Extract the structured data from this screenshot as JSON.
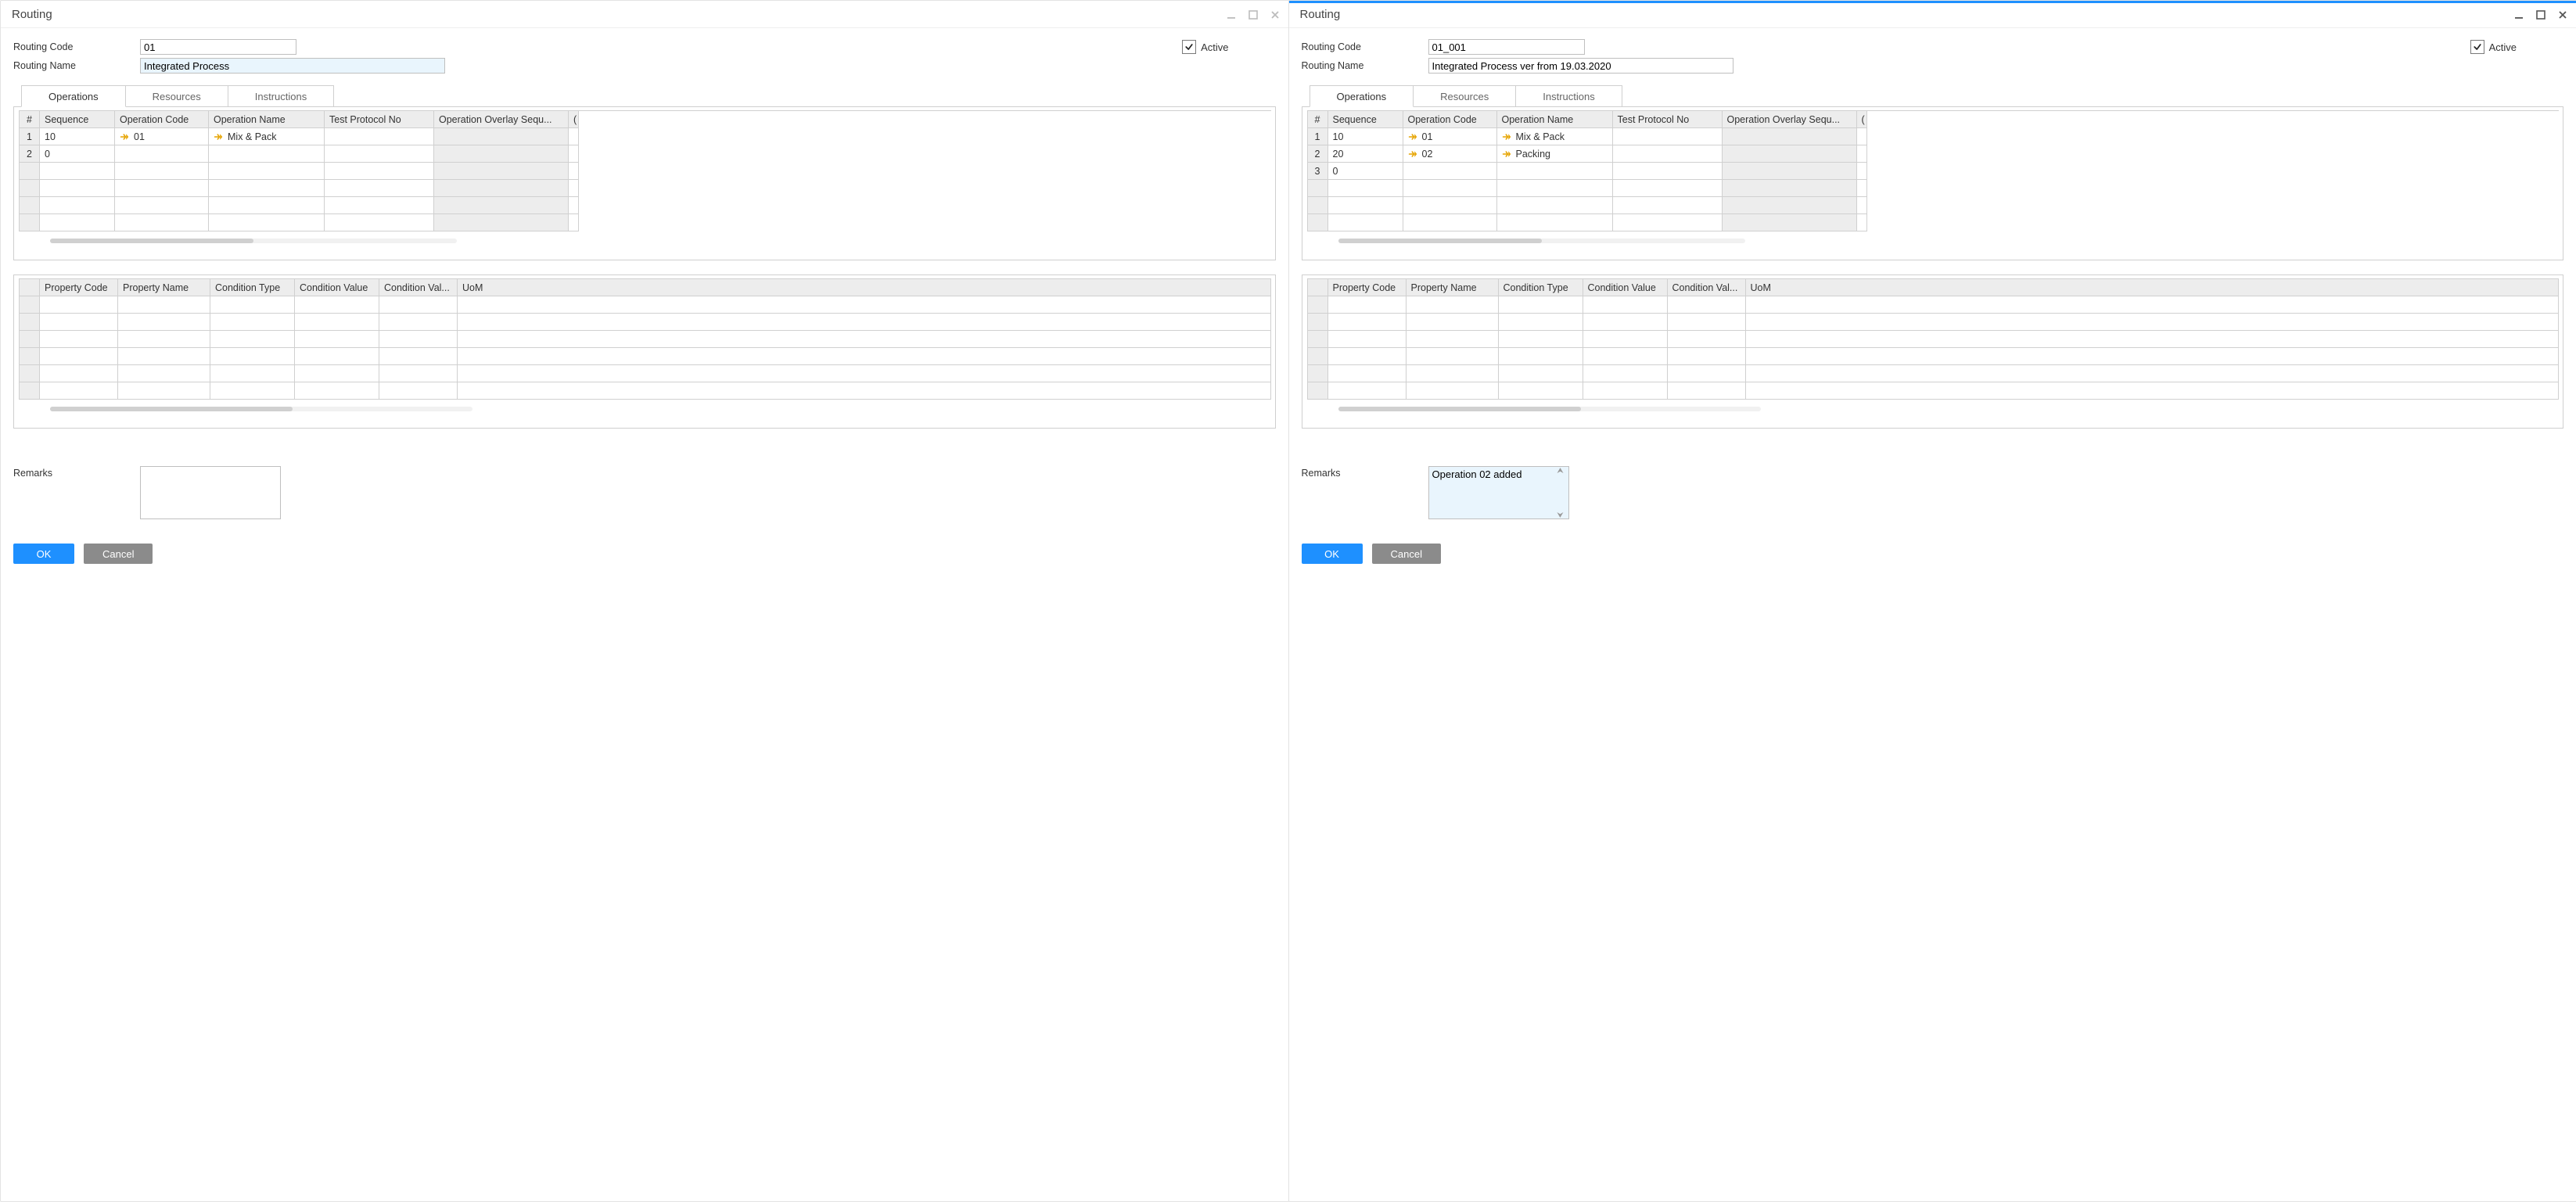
{
  "windows": [
    {
      "title": "Routing",
      "active_window": false,
      "header": {
        "code_label": "Routing Code",
        "name_label": "Routing Name",
        "code": "01",
        "name": "Integrated Process",
        "name_selected": true,
        "active_label": "Active",
        "active": true
      },
      "tabs": {
        "operations": "Operations",
        "resources": "Resources",
        "instructions": "Instructions"
      },
      "ops_grid": {
        "cols": {
          "idx": "#",
          "seq": "Sequence",
          "code": "Operation Code",
          "name": "Operation Name",
          "tp": "Test Protocol No",
          "ov": "Operation Overlay Sequ...",
          "tail": "("
        },
        "rows": [
          {
            "idx": "1",
            "seq": "10",
            "code": "01",
            "name": "Mix & Pack"
          },
          {
            "idx": "2",
            "seq": "0",
            "code": "",
            "name": ""
          }
        ]
      },
      "props_grid": {
        "cols": {
          "pc": "Property Code",
          "pn": "Property Name",
          "ct": "Condition Type",
          "cv": "Condition Value",
          "cv2": "Condition Val...",
          "uom": "UoM"
        }
      },
      "remarks_label": "Remarks",
      "remarks": "",
      "remarks_selected": false,
      "buttons": {
        "ok": "OK",
        "cancel": "Cancel"
      }
    },
    {
      "title": "Routing",
      "active_window": true,
      "header": {
        "code_label": "Routing Code",
        "name_label": "Routing Name",
        "code": "01_001",
        "name": "Integrated Process ver from 19.03.2020",
        "name_selected": false,
        "active_label": "Active",
        "active": true
      },
      "tabs": {
        "operations": "Operations",
        "resources": "Resources",
        "instructions": "Instructions"
      },
      "ops_grid": {
        "cols": {
          "idx": "#",
          "seq": "Sequence",
          "code": "Operation Code",
          "name": "Operation Name",
          "tp": "Test Protocol No",
          "ov": "Operation Overlay Sequ...",
          "tail": "("
        },
        "rows": [
          {
            "idx": "1",
            "seq": "10",
            "code": "01",
            "name": "Mix & Pack"
          },
          {
            "idx": "2",
            "seq": "20",
            "code": "02",
            "name": "Packing"
          },
          {
            "idx": "3",
            "seq": "0",
            "code": "",
            "name": ""
          }
        ]
      },
      "props_grid": {
        "cols": {
          "pc": "Property Code",
          "pn": "Property Name",
          "ct": "Condition Type",
          "cv": "Condition Value",
          "cv2": "Condition Val...",
          "uom": "UoM"
        }
      },
      "remarks_label": "Remarks",
      "remarks": "Operation 02 added",
      "remarks_selected": true,
      "buttons": {
        "ok": "OK",
        "cancel": "Cancel"
      }
    }
  ]
}
